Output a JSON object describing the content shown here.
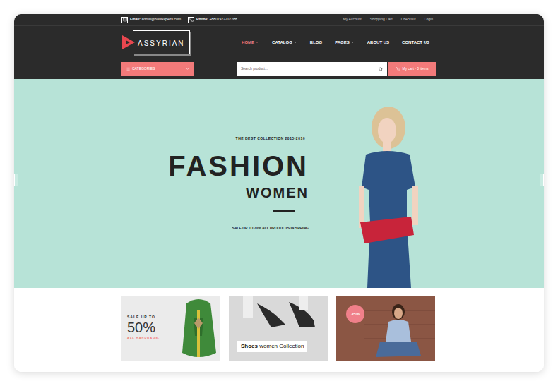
{
  "top_bar": {
    "email_label": "Email:",
    "email": "admin@bootexperts.com",
    "phone_label": "Phone:",
    "phone": "+8801922202288",
    "links": [
      "My Account",
      "Shopping Cart",
      "Checkout",
      "Login"
    ]
  },
  "logo": "ASSYRIAN",
  "nav": [
    {
      "label": "HOME",
      "selected": true,
      "expandable": true
    },
    {
      "label": "CATALOG",
      "selected": false,
      "expandable": true
    },
    {
      "label": "BLOG",
      "selected": false,
      "expandable": false
    },
    {
      "label": "PAGES",
      "selected": false,
      "expandable": true
    },
    {
      "label": "ABOUT US",
      "selected": false,
      "expandable": false
    },
    {
      "label": "CONTACT US",
      "selected": false,
      "expandable": false
    }
  ],
  "categories": {
    "label": "CATEGORIES"
  },
  "search": {
    "placeholder": "Search product..."
  },
  "cart": {
    "label": "My cart - 0 items"
  },
  "hero": {
    "eyebrow": "THE BEST COLLECTION 2015-2016",
    "title": "FASHION",
    "subtitle": "WOMEN",
    "tagline": "SALE UP TO 70% ALL PRODUCTS IN SPRING"
  },
  "banners": [
    {
      "kind": "sale",
      "eyebrow": "SALE UP TO",
      "value": "50%",
      "caption": "ALL HANDBAGS."
    },
    {
      "kind": "label",
      "title": "Shoes",
      "text": "women Collection"
    },
    {
      "kind": "badge",
      "badge": "35%"
    }
  ]
}
